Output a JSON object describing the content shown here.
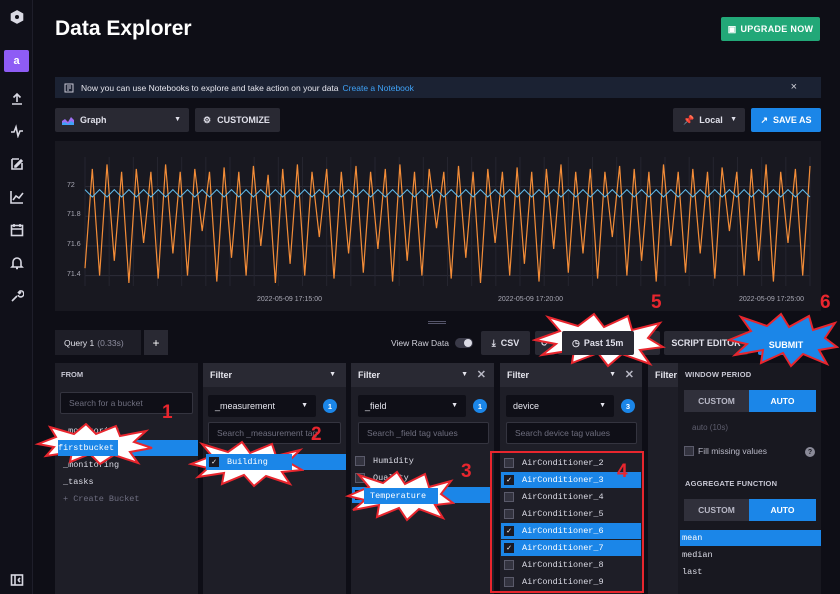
{
  "nav": {
    "avatar": "a",
    "icons": [
      "logo-icon",
      "upload-icon",
      "pulse-icon",
      "edit-icon",
      "chart-icon",
      "calendar-icon",
      "bell-icon",
      "wrench-icon",
      "collapse-icon"
    ]
  },
  "header": {
    "title": "Data Explorer",
    "upgrade": "UPGRADE NOW"
  },
  "banner": {
    "text": "Now you can use Notebooks to explore and take action on your data",
    "link": "Create a Notebook",
    "close": "×"
  },
  "toolbar": {
    "graph": "Graph",
    "customize": "CUSTOMIZE",
    "timezone": "Local",
    "save_as": "SAVE AS"
  },
  "chart_data": {
    "type": "line",
    "y_ticks": [
      "72",
      "71.8",
      "71.6",
      "71.4"
    ],
    "ylim": [
      71.33,
      72.2
    ],
    "x_ticks": [
      "2022-05-09 17:15:00",
      "2022-05-09 17:20:00",
      "2022-05-09 17:25:00"
    ],
    "grid": true,
    "series": [
      {
        "color": "#f48d38",
        "values": [
          71.45,
          72.12,
          71.4,
          72.15,
          71.5,
          72.1,
          71.35,
          72.12,
          71.62,
          72.1,
          71.38,
          72.15,
          71.55,
          72.1,
          71.4,
          72.12,
          71.7,
          72.1,
          71.36,
          72.13,
          71.52,
          72.1,
          71.4,
          72.14,
          71.6,
          72.08,
          71.35,
          72.12,
          71.48,
          72.15,
          71.4,
          72.1,
          71.66,
          72.12,
          71.38,
          72.1,
          71.55,
          72.14,
          71.42,
          72.1,
          71.58,
          72.12,
          71.36,
          72.15,
          71.5,
          72.1,
          71.4,
          72.12,
          71.72,
          72.1,
          71.38,
          72.14,
          71.52,
          72.1,
          71.35,
          72.12,
          71.62,
          72.1,
          71.4,
          72.13,
          71.48,
          72.1,
          71.36,
          72.12,
          71.58,
          72.15,
          71.42,
          72.1,
          71.55,
          72.12,
          71.38,
          72.1,
          71.66,
          72.14,
          71.4,
          72.12,
          71.5,
          72.1,
          71.36,
          72.15,
          71.6,
          72.1,
          71.42,
          72.12,
          71.55,
          72.1,
          71.38,
          72.13,
          71.7,
          72.1,
          71.4,
          72.12,
          71.5,
          72.15,
          71.36,
          72.1,
          71.62,
          72.12,
          71.4,
          72.14
        ]
      },
      {
        "color": "#5fb9e8",
        "values": [
          71.98,
          71.93,
          71.98,
          71.93,
          71.98,
          71.93,
          71.98,
          71.93,
          71.98,
          71.93,
          71.98,
          71.93,
          71.98,
          71.93,
          71.98,
          71.93,
          71.98,
          71.93,
          71.98,
          71.93,
          71.98,
          71.93,
          71.98,
          71.93,
          71.98,
          71.93,
          71.98,
          71.93,
          71.98,
          71.93,
          71.98,
          71.93,
          71.98,
          71.93,
          71.98,
          71.93,
          71.98,
          71.93,
          71.98,
          71.93,
          71.98,
          71.93,
          71.98,
          71.93,
          71.98,
          71.93,
          71.98,
          71.93,
          71.98,
          71.93,
          71.98,
          71.93,
          71.98,
          71.93,
          71.98,
          71.93,
          71.98,
          71.93,
          71.98,
          71.93,
          71.98,
          71.93,
          71.98,
          71.93,
          71.98,
          71.93,
          71.98,
          71.93,
          71.98,
          71.93,
          71.98,
          71.93,
          71.98,
          71.93,
          71.98,
          71.93,
          71.98,
          71.93,
          71.98,
          71.93,
          71.98,
          71.93,
          71.98,
          71.93,
          71.98,
          71.93,
          71.98,
          71.93,
          71.98,
          71.93,
          71.98,
          71.93,
          71.98,
          71.93,
          71.98,
          71.93,
          71.98,
          71.93,
          71.98,
          71.93
        ]
      }
    ]
  },
  "query": {
    "tab": "Query 1",
    "time": "(0.33s)",
    "add": "+",
    "view_raw": "View Raw Data",
    "csv": "CSV",
    "range": "Past 15m",
    "script_editor": "SCRIPT EDITOR",
    "submit": "SUBMIT"
  },
  "from": {
    "title": "FROM",
    "search_placeholder": "Search for a bucket",
    "items": [
      "_monitoring",
      "firstbucket",
      "_monitoring",
      "_tasks",
      "+ Create Bucket"
    ]
  },
  "filter1": {
    "title": "Filter",
    "key": "_measurement",
    "count": "1",
    "search_placeholder": "Search _measurement tag",
    "items": [
      "Building"
    ]
  },
  "filter2": {
    "title": "Filter",
    "key": "_field",
    "count": "1",
    "search_placeholder": "Search _field tag values",
    "items": [
      "Humidity",
      "Quality",
      "Temperature"
    ]
  },
  "filter3": {
    "title": "Filter",
    "key": "device",
    "count": "3",
    "search_placeholder": "Search device tag values",
    "items": [
      "AirConditioner_2",
      "AirConditioner_3",
      "AirConditioner_4",
      "AirConditioner_5",
      "AirConditioner_6",
      "AirConditioner_7",
      "AirConditioner_8",
      "AirConditioner_9"
    ]
  },
  "filter4": {
    "title": "Filter"
  },
  "window": {
    "title": "WINDOW PERIOD",
    "custom": "CUSTOM",
    "auto": "AUTO",
    "auto_value": "auto (10s)",
    "fill_missing": "Fill missing values",
    "aggregate_title": "AGGREGATE FUNCTION",
    "functions": [
      "mean",
      "median",
      "last"
    ]
  },
  "annotations": {
    "numbers": [
      "1",
      "2",
      "3",
      "4",
      "5",
      "6"
    ],
    "color": "#e8262e"
  }
}
